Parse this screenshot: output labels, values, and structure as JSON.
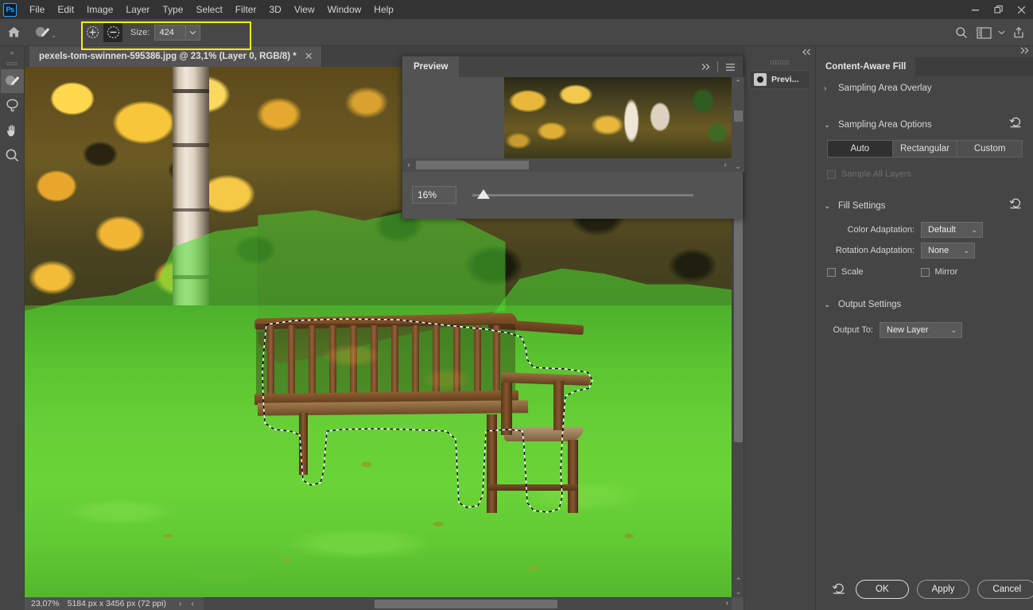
{
  "app": {
    "logo": "Ps"
  },
  "menubar": {
    "items": [
      "File",
      "Edit",
      "Image",
      "Layer",
      "Type",
      "Select",
      "Filter",
      "3D",
      "View",
      "Window",
      "Help"
    ]
  },
  "window_controls": {
    "minimize": "—",
    "restore": "❐",
    "close": "✕"
  },
  "options_bar": {
    "home_icon": "home-icon",
    "tool_preview_icon": "sampling-brush-icon",
    "add_mode_icon": "add-to-sampling-area-icon",
    "subtract_mode_icon": "subtract-from-sampling-area-icon",
    "active_mode": "subtract",
    "size_label": "Size:",
    "size_value": "424",
    "size_dropdown_icon": "chevron-down-icon",
    "right_icons": [
      "search-icon",
      "workspace-icon",
      "chevron-down-icon",
      "share-icon"
    ]
  },
  "toolbar": {
    "tools": [
      {
        "name": "sampling-brush-tool",
        "active": true
      },
      {
        "name": "lasso-tool",
        "active": false
      },
      {
        "name": "hand-tool",
        "active": false
      },
      {
        "name": "zoom-tool",
        "active": false
      }
    ]
  },
  "document": {
    "tab_title": "pexels-tom-swinnen-595386.jpg @ 23,1% (Layer 0, RGB/8) *",
    "close_icon": "close-icon"
  },
  "status_bar": {
    "zoom": "23,07%",
    "dimensions": "5184 px x 3456 px (72 ppi)",
    "arrow_right": "›",
    "arrow_left": "‹"
  },
  "preview_panel": {
    "tab_label": "Preview",
    "expand_icon": "double-chevron-right-icon",
    "menu_icon": "panel-menu-icon",
    "zoom_value": "16%",
    "scroll_left_icon": "chevron-left-icon",
    "scroll_right_icon": "chevron-right-icon",
    "scroll_up_icon": "chevron-up-icon",
    "scroll_down_icon": "chevron-down-icon"
  },
  "mini_dock": {
    "collapse_icon": "double-chevron-left-icon",
    "tab_label": "Previ...",
    "tab_icon": "preview-thumbnail-icon"
  },
  "right_panel": {
    "collapse_icon": "double-chevron-right-icon",
    "tab_label": "Content-Aware Fill",
    "sections": {
      "sampling_area_overlay": {
        "title": "Sampling Area Overlay",
        "arrow": "›",
        "expanded": false
      },
      "sampling_area_options": {
        "title": "Sampling Area Options",
        "arrow": "⌄",
        "reset_icon": "reset-icon",
        "segments": [
          "Auto",
          "Rectangular",
          "Custom"
        ],
        "active_segment": "Auto",
        "sample_all_layers_label": "Sample All Layers",
        "sample_all_layers_checked": false,
        "sample_all_layers_disabled": true
      },
      "fill_settings": {
        "title": "Fill Settings",
        "arrow": "⌄",
        "reset_icon": "reset-icon",
        "color_adaptation_label": "Color Adaptation:",
        "color_adaptation_value": "Default",
        "rotation_adaptation_label": "Rotation Adaptation:",
        "rotation_adaptation_value": "None",
        "scale_label": "Scale",
        "scale_checked": false,
        "mirror_label": "Mirror",
        "mirror_checked": false
      },
      "output_settings": {
        "title": "Output Settings",
        "arrow": "⌄",
        "output_to_label": "Output To:",
        "output_to_value": "New Layer"
      }
    },
    "footer": {
      "reset_icon": "reset-icon",
      "ok_label": "OK",
      "apply_label": "Apply",
      "cancel_label": "Cancel"
    }
  },
  "colors": {
    "ui_bg": "#535353",
    "panel_bg": "#454545",
    "menubar_bg": "#333333",
    "highlight_yellow": "#f5f500",
    "sampling_overlay_green": "#4cdc32",
    "text": "#d6d6d6"
  }
}
